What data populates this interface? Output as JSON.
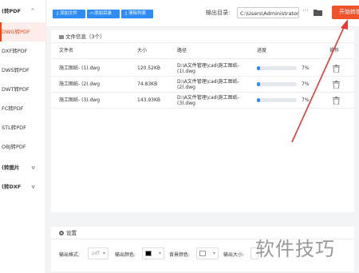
{
  "sidebar": {
    "items": [
      {
        "label": "(转PDF",
        "group": true,
        "chevron": "^"
      },
      {
        "label": "DWG转PDF",
        "active": true
      },
      {
        "label": "DXF转PDF"
      },
      {
        "label": "DWS转PDF"
      },
      {
        "label": "DWT转PDF"
      },
      {
        "label": "FC转PDF"
      },
      {
        "label": "STL转PDF"
      },
      {
        "label": "OBJ转PDF"
      },
      {
        "label": "(转图片",
        "group": true,
        "chevron": "v"
      },
      {
        "label": "(转DXF",
        "group": true,
        "chevron": "v"
      }
    ]
  },
  "toolbar": {
    "add_file": "添加文件",
    "add_folder": "添加目录",
    "clear_list": "清除列表",
    "output_label": "输出目录:",
    "output_path": "C:\\Users\\Administrator",
    "more": "···",
    "start": "开始转换"
  },
  "file_panel": {
    "title": "文件信息（3个）",
    "columns": [
      "文件名",
      "大小",
      "路径",
      "进度",
      "操作"
    ],
    "rows": [
      {
        "name": "施工图纸- (1).dwg",
        "size": "120.52KB",
        "path": "D:\\A文件管理\\cad\\施工图纸-(1).dwg",
        "progress_text": "7%",
        "progress": 0.07
      },
      {
        "name": "施工图纸- (2).dwg",
        "size": "74.83KB",
        "path": "D:\\A文件管理\\cad\\施工图纸-(2).dwg",
        "progress_text": "7%",
        "progress": 0.07
      },
      {
        "name": "施工图纸- (3).dwg",
        "size": "143.93KB",
        "path": "D:\\A文件管理\\cad\\施工图纸-(3).dwg",
        "progress_text": "7%",
        "progress": 0.07
      }
    ]
  },
  "settings": {
    "title": "设置",
    "format_label": "输出格式:",
    "format_value": "pdf",
    "color_label": "输出颜色:",
    "color_value": "#000000",
    "bg_label": "背景颜色:",
    "bg_value": "#ffffff",
    "size_label": "输出大小:"
  },
  "watermark": "软件技巧",
  "colors": {
    "accent": "#2f8cf4",
    "start": "#f0532a",
    "arrow": "#e53935"
  }
}
